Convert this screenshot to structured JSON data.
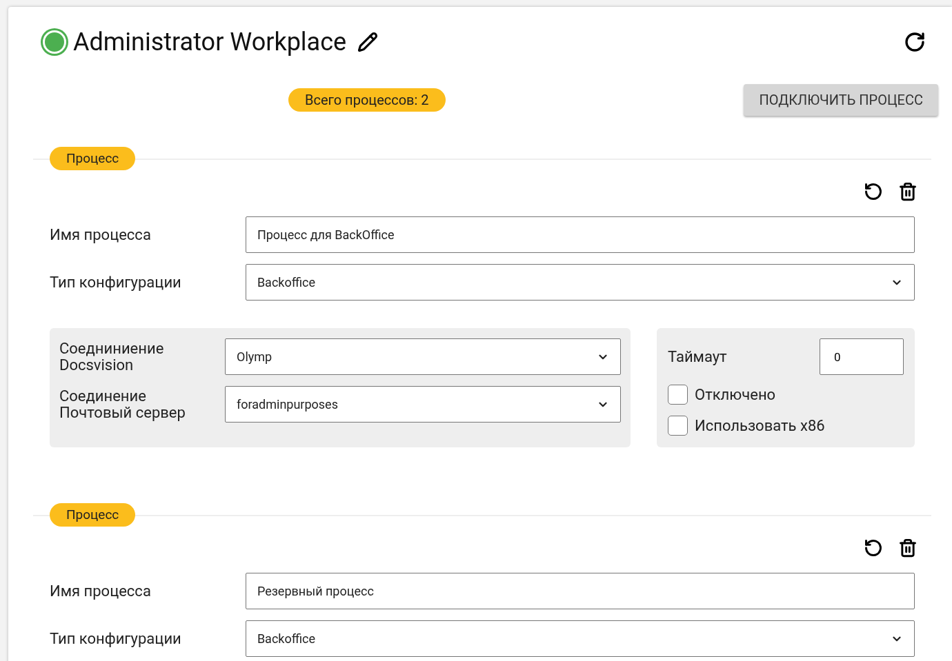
{
  "header": {
    "title": "Administrator Workplace",
    "online": true
  },
  "total_badge": "Всего процессов: 2",
  "connect_button": "ПОДКЛЮЧИТЬ ПРОЦЕСС",
  "processes": [
    {
      "badge": "Процесс",
      "fields": [
        {
          "kind": "text",
          "label": "Имя процесса",
          "value": "Процесс для BackOffice"
        },
        {
          "kind": "select",
          "label": "Тип конфигурации",
          "value": "Backoffice"
        }
      ],
      "settings": {
        "connections": [
          {
            "label": "Соедниниение\nDocsvision",
            "value": "Olymp"
          },
          {
            "label": "Соединение\nПочтовый сервер",
            "value": "foradminpurposes"
          }
        ],
        "timeout": {
          "label": "Таймаут",
          "value": "0"
        },
        "checkboxes": [
          {
            "label": "Отключено",
            "checked": false
          },
          {
            "label": "Использовать x86",
            "checked": false
          }
        ]
      }
    },
    {
      "badge": "Процесс",
      "fields": [
        {
          "kind": "text",
          "label": "Имя процесса",
          "value": "Резервный процесс"
        },
        {
          "kind": "select",
          "label": "Тип конфигурации",
          "value": "Backoffice"
        }
      ]
    }
  ]
}
